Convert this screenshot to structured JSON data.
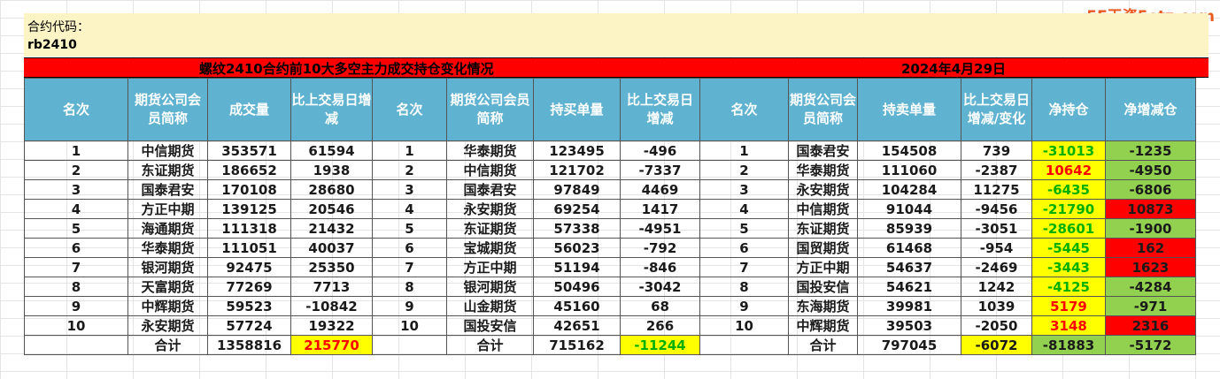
{
  "watermark": "5E天资5etz.com",
  "contract_label": "合约代码：",
  "contract_code": "rb2410",
  "title": "螺纹2410合约前10大多空主力成交持仓变化情况",
  "date": "2024年4月29日",
  "headers": [
    "名次",
    "期货公司会员简称",
    "成交量",
    "比上交易日增减",
    "名次",
    "期货公司会员简称",
    "持买单量",
    "比上交易日增减",
    "名次",
    "期货公司会员简称",
    "持卖单量",
    "比上交易日增减/变化",
    "净持仓",
    "净增减仓"
  ],
  "rows": [
    [
      "1",
      "中信期货",
      "353571",
      "61594",
      "1",
      "华泰期货",
      "123495",
      "-496",
      "1",
      "国泰君安",
      "154508",
      "739",
      "-31013",
      "-1235"
    ],
    [
      "2",
      "东证期货",
      "186652",
      "1938",
      "2",
      "中信期货",
      "121702",
      "-7337",
      "2",
      "华泰期货",
      "111060",
      "-2387",
      "10642",
      "-4950"
    ],
    [
      "3",
      "国泰君安",
      "170108",
      "28680",
      "3",
      "国泰君安",
      "97849",
      "4469",
      "3",
      "永安期货",
      "104284",
      "11275",
      "-6435",
      "-6806"
    ],
    [
      "4",
      "方正中期",
      "139125",
      "20546",
      "4",
      "永安期货",
      "69254",
      "1417",
      "4",
      "中信期货",
      "91044",
      "-9456",
      "-21790",
      "10873"
    ],
    [
      "5",
      "海通期货",
      "111318",
      "21432",
      "5",
      "东证期货",
      "57338",
      "-4951",
      "5",
      "东证期货",
      "85939",
      "-3051",
      "-28601",
      "-1900"
    ],
    [
      "6",
      "华泰期货",
      "111051",
      "40037",
      "6",
      "宝城期货",
      "56023",
      "-792",
      "6",
      "国贸期货",
      "61468",
      "-954",
      "-5445",
      "162"
    ],
    [
      "7",
      "银河期货",
      "92475",
      "25350",
      "7",
      "方正中期",
      "51194",
      "-846",
      "7",
      "方正中期",
      "54637",
      "-2469",
      "-3443",
      "1623"
    ],
    [
      "8",
      "天富期货",
      "77269",
      "7713",
      "8",
      "银河期货",
      "50496",
      "-3042",
      "8",
      "国投安信",
      "54621",
      "1242",
      "-4125",
      "-4284"
    ],
    [
      "9",
      "中辉期货",
      "59523",
      "-10842",
      "9",
      "山金期货",
      "45160",
      "68",
      "9",
      "东海期货",
      "39981",
      "1039",
      "5179",
      "-971"
    ],
    [
      "10",
      "永安期货",
      "57724",
      "19322",
      "10",
      "国投安信",
      "42651",
      "266",
      "10",
      "中辉期货",
      "39503",
      "-2050",
      "3148",
      "2316"
    ]
  ],
  "total": [
    "",
    "合计",
    "1358816",
    "215770",
    "",
    "合计",
    "715162",
    "-11244",
    "",
    "合计",
    "797045",
    "-6072",
    "-81883",
    "-5172"
  ]
}
